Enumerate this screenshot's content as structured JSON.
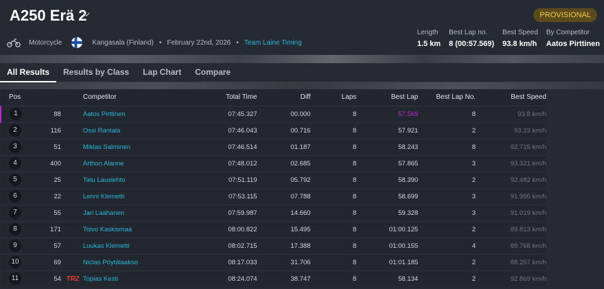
{
  "header": {
    "title": "A250 Erä 2",
    "status_badge": "PROVISIONAL",
    "sport": "Motorcycle",
    "location": "Kangasala (Finland)",
    "date": "February 22nd, 2026",
    "organizer": "Team Laine Timing",
    "stats": [
      {
        "label": "Length",
        "value": "1.5 km"
      },
      {
        "label": "Best Lap no.",
        "value": "8 (00:57.569)"
      },
      {
        "label": "Best Speed",
        "value": "93.8 km/h"
      },
      {
        "label": "By Competitor",
        "value": "Aatos Pirttinen"
      }
    ]
  },
  "tabs": [
    "All Results",
    "Results by Class",
    "Lap Chart",
    "Compare"
  ],
  "active_tab": "All Results",
  "table": {
    "columns": [
      "Pos",
      "Competitor",
      "Total Time",
      "Diff",
      "Laps",
      "Best Lap",
      "Best Lap No.",
      "Best Speed"
    ],
    "rows": [
      {
        "pos": "1",
        "num": "88",
        "tag": "",
        "name": "Aatos Pirttinen",
        "total": "07:45.327",
        "diff": "00.000",
        "laps": "8",
        "best": "57.569",
        "best_no": "8",
        "speed": "93.8 km/h"
      },
      {
        "pos": "2",
        "num": "116",
        "tag": "",
        "name": "Ossi Rantala",
        "total": "07:46.043",
        "diff": "00.716",
        "laps": "8",
        "best": "57.921",
        "best_no": "2",
        "speed": "93.23 km/h"
      },
      {
        "pos": "3",
        "num": "51",
        "tag": "",
        "name": "Miklas Salminen",
        "total": "07:46.514",
        "diff": "01.187",
        "laps": "8",
        "best": "58.243",
        "best_no": "8",
        "speed": "92.715 km/h"
      },
      {
        "pos": "4",
        "num": "400",
        "tag": "",
        "name": "Arthon Alanne",
        "total": "07:48.012",
        "diff": "02.685",
        "laps": "8",
        "best": "57.865",
        "best_no": "3",
        "speed": "93.321 km/h"
      },
      {
        "pos": "5",
        "num": "25",
        "tag": "",
        "name": "Tatu Lauslehto",
        "total": "07:51.119",
        "diff": "05.792",
        "laps": "8",
        "best": "58.390",
        "best_no": "2",
        "speed": "92.482 km/h"
      },
      {
        "pos": "6",
        "num": "22",
        "tag": "",
        "name": "Lenni Klemetti",
        "total": "07:53.115",
        "diff": "07.788",
        "laps": "8",
        "best": "58.699",
        "best_no": "3",
        "speed": "91.995 km/h"
      },
      {
        "pos": "7",
        "num": "55",
        "tag": "",
        "name": "Jari Laahanen",
        "total": "07:59.987",
        "diff": "14.660",
        "laps": "8",
        "best": "59.328",
        "best_no": "3",
        "speed": "91.019 km/h"
      },
      {
        "pos": "8",
        "num": "171",
        "tag": "",
        "name": "Toivo Kaskismaa",
        "total": "08:00.822",
        "diff": "15.495",
        "laps": "8",
        "best": "01:00.125",
        "best_no": "2",
        "speed": "89.813 km/h"
      },
      {
        "pos": "9",
        "num": "57",
        "tag": "",
        "name": "Luukas Klemetti",
        "total": "08:02.715",
        "diff": "17.388",
        "laps": "8",
        "best": "01:00.155",
        "best_no": "4",
        "speed": "89.768 km/h"
      },
      {
        "pos": "10",
        "num": "69",
        "tag": "",
        "name": "Niclas Pöytälaakso",
        "total": "08:17.033",
        "diff": "31.706",
        "laps": "8",
        "best": "01:01.185",
        "best_no": "2",
        "speed": "88.257 km/h"
      },
      {
        "pos": "11",
        "num": "54",
        "tag": "TR2",
        "name": "Topias Kesti",
        "total": "08:24.074",
        "diff": "38.747",
        "laps": "8",
        "best": "58.134",
        "best_no": "2",
        "speed": "92.869 km/h"
      }
    ]
  },
  "colors": {
    "accent": "#2ab6d8",
    "best_lap": "#c026d3",
    "badge_text": "#f0c94a",
    "tag": "#e33b3b"
  }
}
